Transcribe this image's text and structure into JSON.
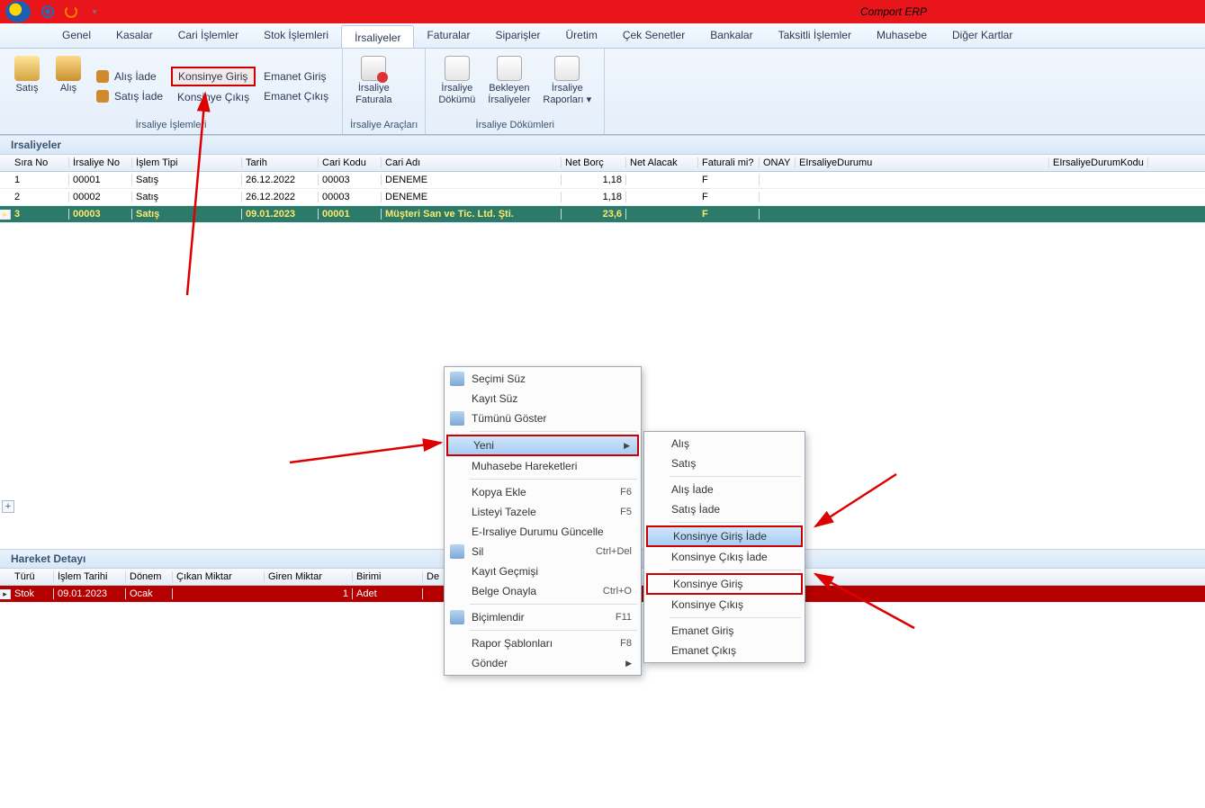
{
  "app_title": "Comport ERP",
  "menu": [
    "Genel",
    "Kasalar",
    "Cari İşlemler",
    "Stok İşlemleri",
    "İrsaliyeler",
    "Faturalar",
    "Siparişler",
    "Üretim",
    "Çek Senetler",
    "Bankalar",
    "Taksitli İşlemler",
    "Muhasebe",
    "Diğer Kartlar"
  ],
  "menu_active": 4,
  "ribbon": {
    "group1": {
      "label": "İrsaliye İşlemleri",
      "satis": "Satış",
      "alis": "Alış",
      "alis_iade": "Alış İade",
      "satis_iade": "Satış İade",
      "konsinye_giris": "Konsinye Giriş",
      "konsinye_cikis": "Konsinye Çıkış",
      "emanet_giris": "Emanet Giriş",
      "emanet_cikis": "Emanet Çıkış"
    },
    "group2": {
      "label": "İrsaliye Araçları",
      "faturala": "İrsaliye\nFaturala"
    },
    "group3": {
      "label": "İrsaliye Dökümleri",
      "dokumu": "İrsaliye\nDökümü",
      "bekleyen": "Bekleyen\nİrsaliyeler",
      "raporlari": "İrsaliye\nRaporları ▾"
    }
  },
  "panel_title": "Irsaliyeler",
  "grid": {
    "headers": [
      "Sıra No",
      "İrsaliye No",
      "İşlem Tipi",
      "Tarih",
      "Cari Kodu",
      "Cari Adı",
      "Net Borç",
      "Net Alacak",
      "Faturali mi?",
      "ONAY",
      "EIrsaliyeDurumu",
      "EIrsaliyeDurumKodu"
    ],
    "rows": [
      {
        "sira": "1",
        "irs": "00001",
        "islem": "Satış",
        "tarih": "26.12.2022",
        "cari": "00003",
        "cad": "DENEME",
        "nb": "1,18",
        "na": "",
        "fat": "F",
        "onay": "",
        "eid": "",
        "edk": ""
      },
      {
        "sira": "2",
        "irs": "00002",
        "islem": "Satış",
        "tarih": "26.12.2022",
        "cari": "00003",
        "cad": "DENEME",
        "nb": "1,18",
        "na": "",
        "fat": "F",
        "onay": "",
        "eid": "",
        "edk": ""
      },
      {
        "sira": "3",
        "irs": "00003",
        "islem": "Satış",
        "tarih": "09.01.2023",
        "cari": "00001",
        "cad": "Müşteri San ve Tic. Ltd. Şti.",
        "nb": "23,6",
        "na": "",
        "fat": "F",
        "onay": "",
        "eid": "",
        "edk": ""
      }
    ],
    "selected": 2
  },
  "context_menu": {
    "items": [
      {
        "label": "Seçimi Süz",
        "icon": true
      },
      {
        "label": "Kayıt Süz"
      },
      {
        "label": "Tümünü Göster",
        "icon": true,
        "sep_after": true
      },
      {
        "label": "Yeni",
        "sub": true,
        "selected": true,
        "highlight": true
      },
      {
        "label": "Muhasebe Hareketleri",
        "sep_after": true
      },
      {
        "label": "Kopya Ekle",
        "short": "F6"
      },
      {
        "label": "Listeyi Tazele",
        "short": "F5"
      },
      {
        "label": "E-Irsaliye Durumu Güncelle"
      },
      {
        "label": "Sil",
        "short": "Ctrl+Del",
        "icon": true
      },
      {
        "label": "Kayıt Geçmişi"
      },
      {
        "label": "Belge Onayla",
        "short": "Ctrl+O",
        "sep_after": true
      },
      {
        "label": "Biçimlendir",
        "short": "F11",
        "icon": true,
        "sep_after": true
      },
      {
        "label": "Rapor Şablonları",
        "short": "F8"
      },
      {
        "label": "Gönder",
        "sub": true
      }
    ],
    "submenu": [
      {
        "label": "Alış"
      },
      {
        "label": "Satış",
        "sep_after": true
      },
      {
        "label": "Alış İade"
      },
      {
        "label": "Satış İade",
        "sep_after": true
      },
      {
        "label": "Konsinye Giriş İade",
        "selected": true,
        "highlight": true
      },
      {
        "label": "Konsinye Çıkış İade",
        "sep_after": true
      },
      {
        "label": "Konsinye Giriş",
        "highlight": true
      },
      {
        "label": "Konsinye Çıkış",
        "sep_after": true
      },
      {
        "label": "Emanet Giriş"
      },
      {
        "label": "Emanet Çıkış"
      }
    ]
  },
  "detail": {
    "title": "Hareket Detayı",
    "headers": [
      "Türü",
      "İşlem Tarihi",
      "Dönem",
      "Çıkan Miktar",
      "Giren Miktar",
      "Birimi",
      "De"
    ],
    "row": {
      "tur": "Stok",
      "it": "09.01.2023",
      "don": "Ocak",
      "cm": "",
      "gm": "1",
      "bir": "Adet",
      "de": ""
    }
  }
}
